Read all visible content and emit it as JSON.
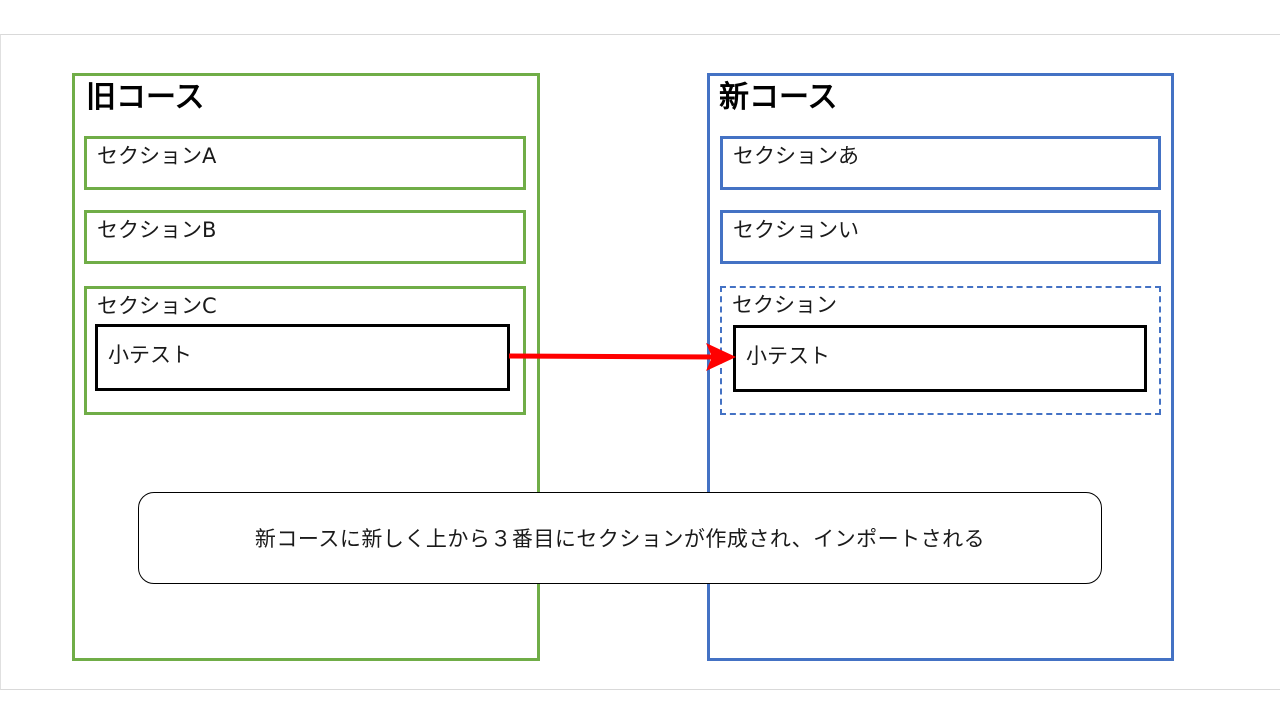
{
  "old_course": {
    "title": "旧コース",
    "sections": [
      {
        "label": "セクションA"
      },
      {
        "label": "セクションB"
      },
      {
        "label": "セクションC",
        "quiz": "小テスト"
      }
    ]
  },
  "new_course": {
    "title": "新コース",
    "sections": [
      {
        "label": "セクションあ"
      },
      {
        "label": "セクションい"
      },
      {
        "label": "セクション",
        "quiz": "小テスト"
      }
    ]
  },
  "callout": {
    "text": "新コースに新しく上から３番目にセクションが作成され、インポートされる"
  },
  "colors": {
    "old_course": "#70ad47",
    "new_course": "#4472c4",
    "arrow": "#ff0000"
  }
}
